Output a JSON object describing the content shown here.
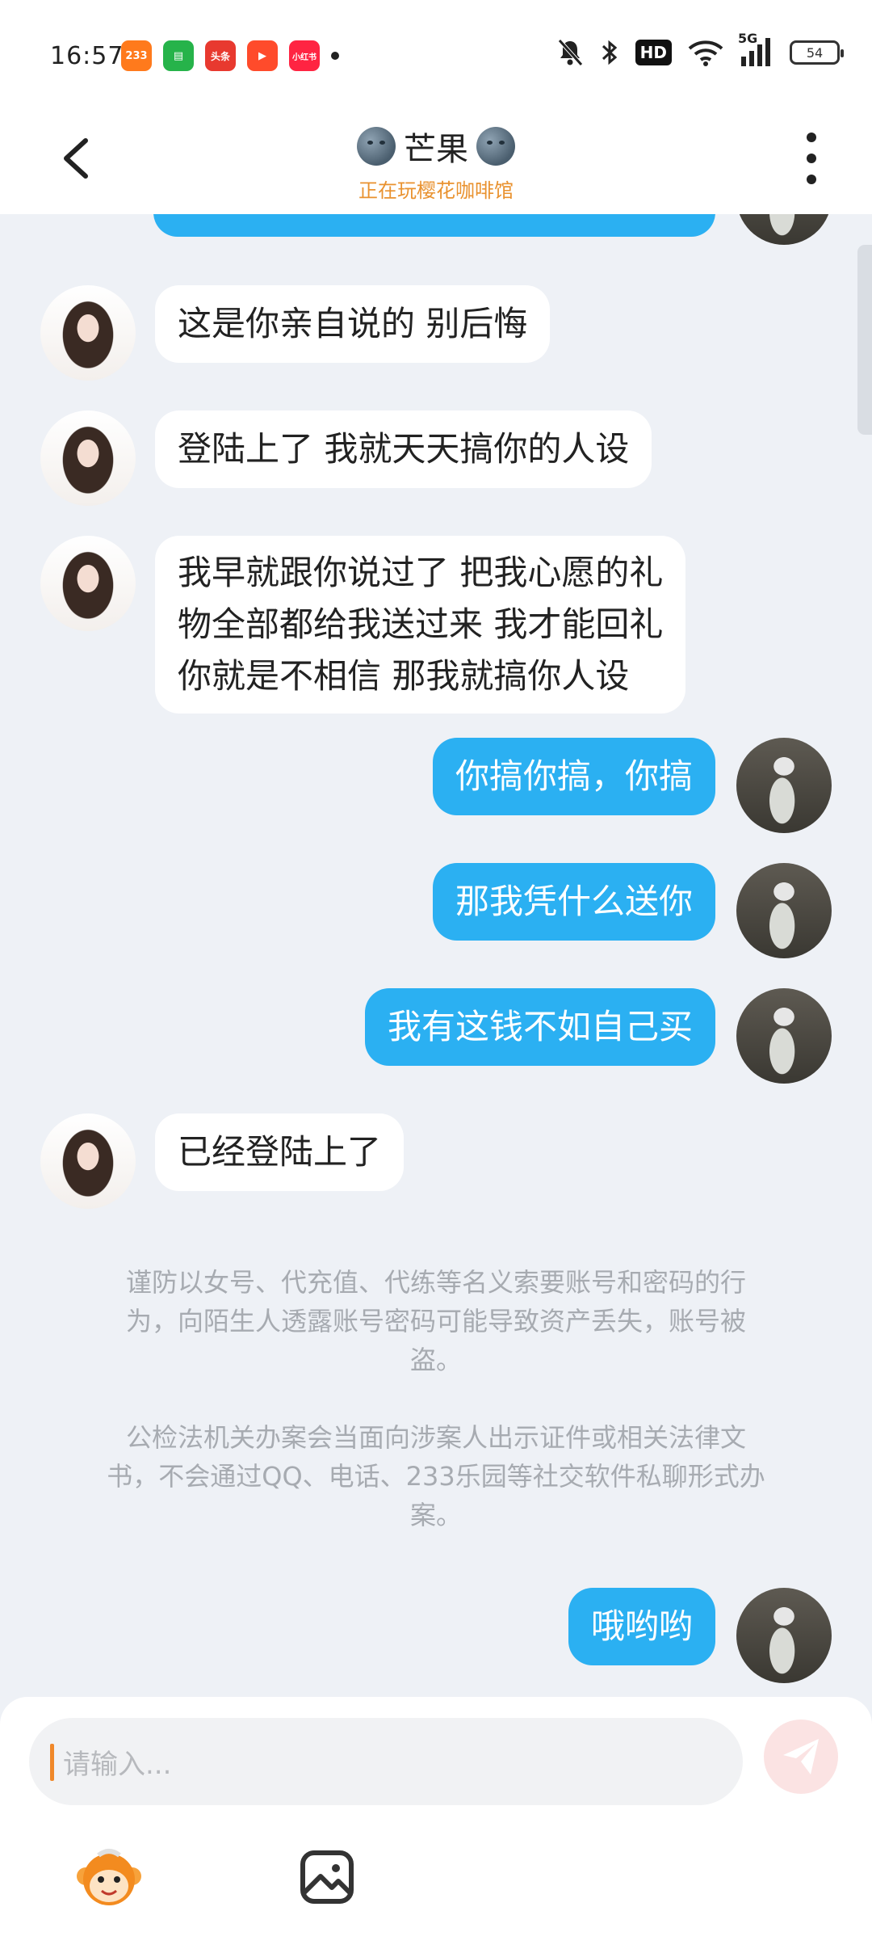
{
  "status_bar": {
    "time": "16:57",
    "apps": [
      {
        "name": "233乐园",
        "color": "#ff7a1c"
      },
      {
        "name": "微信读书",
        "color": "#26b34a"
      },
      {
        "name": "头条",
        "color": "#e8392f"
      },
      {
        "name": "视频",
        "color": "#ff4b2b"
      },
      {
        "name": "小红书",
        "color": "#ff2442"
      }
    ],
    "network": "5G",
    "hd": "HD",
    "battery": "54"
  },
  "header": {
    "title": "芒果",
    "subtitle": "正在玩樱花咖啡馆"
  },
  "messages": [
    {
      "side": "in",
      "text": "这是你亲自说的 别后悔"
    },
    {
      "side": "in",
      "text": "登陆上了 我就天天搞你的人设"
    },
    {
      "side": "in",
      "lines": [
        "我早就跟你说过了 把我心愿的礼",
        "物全部都给我送过来 我才能回礼",
        "你就是不相信 那我就搞你人设"
      ]
    },
    {
      "side": "out",
      "text": "你搞你搞，你搞"
    },
    {
      "side": "out",
      "text": "那我凭什么送你"
    },
    {
      "side": "out",
      "text": "我有这钱不如自己买"
    },
    {
      "side": "in",
      "text": "已经登陆上了"
    },
    {
      "side": "out",
      "text": "哦哟哟"
    }
  ],
  "notices": [
    {
      "lines": [
        "谨防以女号、代充值、代练等名义索要账号和密码的行",
        "为，向陌生人透露账号密码可能导致资产丢失，账号被",
        "盗。"
      ]
    },
    {
      "lines": [
        "公检法机关办案会当面向涉案人出示证件或相关法律文",
        "书，不会通过QQ、电话、233乐园等社交软件私聊形式办",
        "案。"
      ]
    }
  ],
  "input": {
    "placeholder": "请输入..."
  },
  "colors": {
    "outgoing_bubble": "#2bb0f2",
    "incoming_bubble": "#ffffff",
    "background": "#eef1f6",
    "accent": "#e9922f"
  }
}
